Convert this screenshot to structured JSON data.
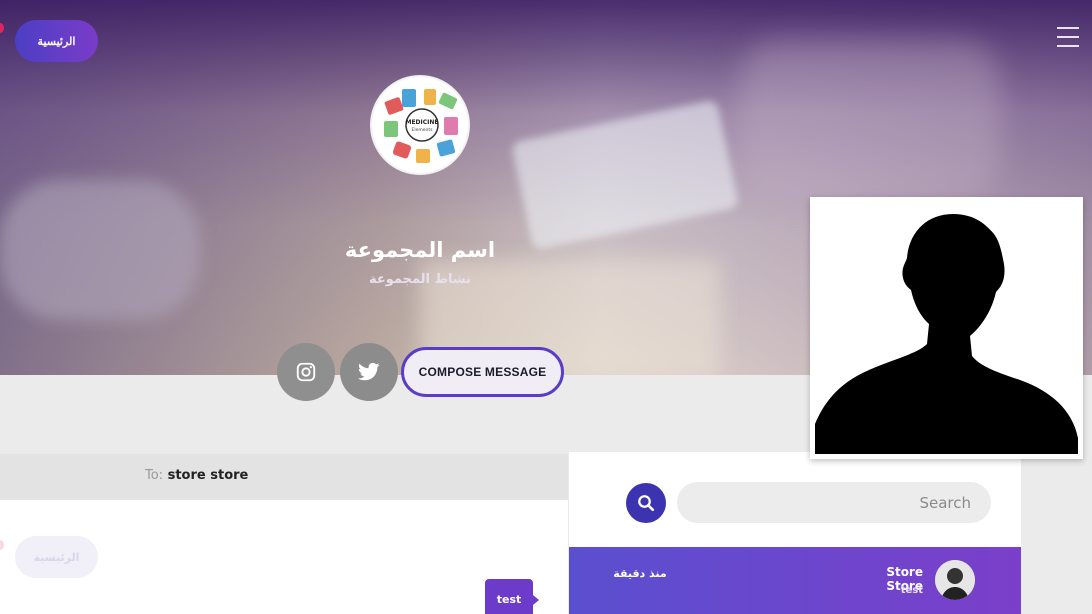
{
  "nav": {
    "home_label": "الرئيسية",
    "menu_icon": "hamburger-icon"
  },
  "group": {
    "name": "اسم المجموعة",
    "activity": "نشاط المجموعة",
    "logo_text_1": "MEDICINE",
    "logo_text_2": "Elements"
  },
  "actions": {
    "compose_label": "COMPOSE MESSAGE",
    "instagram_icon": "instagram-icon",
    "twitter_icon": "twitter-icon"
  },
  "chat": {
    "to_label": "To:",
    "to_name": "store store",
    "bubble_text": "test",
    "faded_home_label": "الرئيسية"
  },
  "contacts": {
    "search_placeholder": "Search",
    "items": [
      {
        "name": "Store Store",
        "last_message": "test",
        "time": "منذ دقيقة"
      }
    ]
  },
  "colors": {
    "accent": "#5a3dc7",
    "search_button": "#3b33b0",
    "contact_gradient_start": "#5a4fcf",
    "contact_gradient_end": "#7b3fca"
  }
}
